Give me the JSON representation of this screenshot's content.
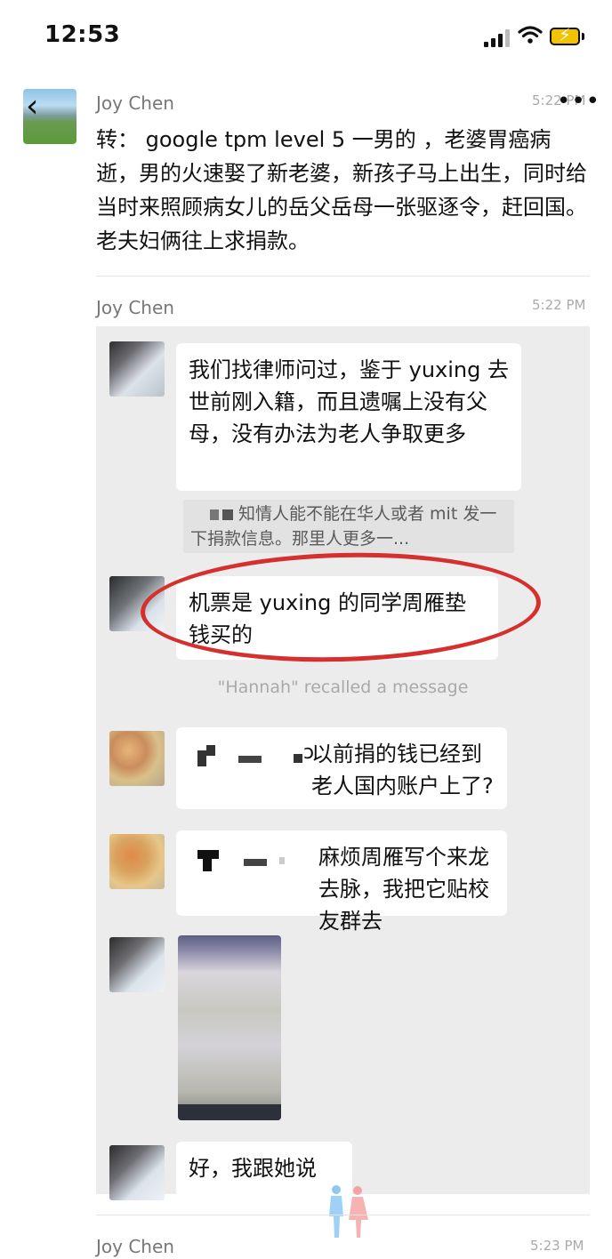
{
  "status_bar": {
    "time": "12:53"
  },
  "post": {
    "sender": "Joy Chen",
    "time": "5:22 PM",
    "text": "转：  google tpm level 5 一男的 ，老婆胃癌病逝，男的火速娶了新老婆，新孩子马上出生，同时给当时来照顾病女儿的岳父岳母一张驱逐令，赶回国。老夫妇俩往上求捐款。"
  },
  "forward": {
    "sender": "Joy Chen",
    "time": "5:22 PM",
    "messages": [
      {
        "text": "我们找律师问过，鉴于 yuxing 去世前刚入籍，而且遗嘱上没有父母，没有办法为老人争取更多"
      },
      {
        "quote": "知情人能不能在华人或者 mit 发一下捐款信息。那里人更多一..."
      },
      {
        "text": "机票是 yuxing 的同学周雁垫钱买的"
      },
      {
        "system": "\"Hannah\" recalled a message"
      },
      {
        "text": "以前捐的钱已经到老人国内账户上了?"
      },
      {
        "text": "麻烦周雁写个来龙去脉，我把它贴校友群去"
      },
      {
        "text": "好，我跟她说"
      }
    ]
  },
  "next": {
    "sender": "Joy Chen",
    "time": "5:23 PM"
  },
  "icons": [
    "back-chevron-icon",
    "more-icon",
    "signal-icon",
    "wifi-icon",
    "battery-icon",
    "watermark-couple-icon"
  ]
}
